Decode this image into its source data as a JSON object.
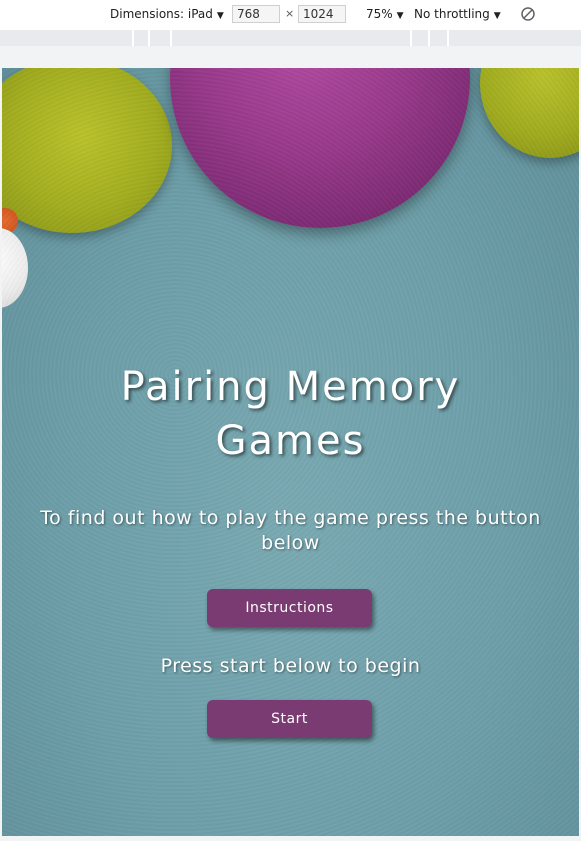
{
  "devtools": {
    "dimensions_label": "Dimensions: iPad",
    "width": "768",
    "height": "1024",
    "times": "×",
    "zoom": "75%",
    "throttling": "No throttling",
    "caret": "▼"
  },
  "page": {
    "title": "Pairing Memory Games",
    "instructions_prompt": "To find out how to play the game press the button below",
    "instructions_button": "Instructions",
    "start_prompt": "Press start below to begin",
    "start_button": "Start"
  },
  "colors": {
    "button": "#7a3a72",
    "background": "#6d9ea8",
    "ball_purple": "#9a3a8c",
    "ball_green": "#a2ad1f"
  }
}
